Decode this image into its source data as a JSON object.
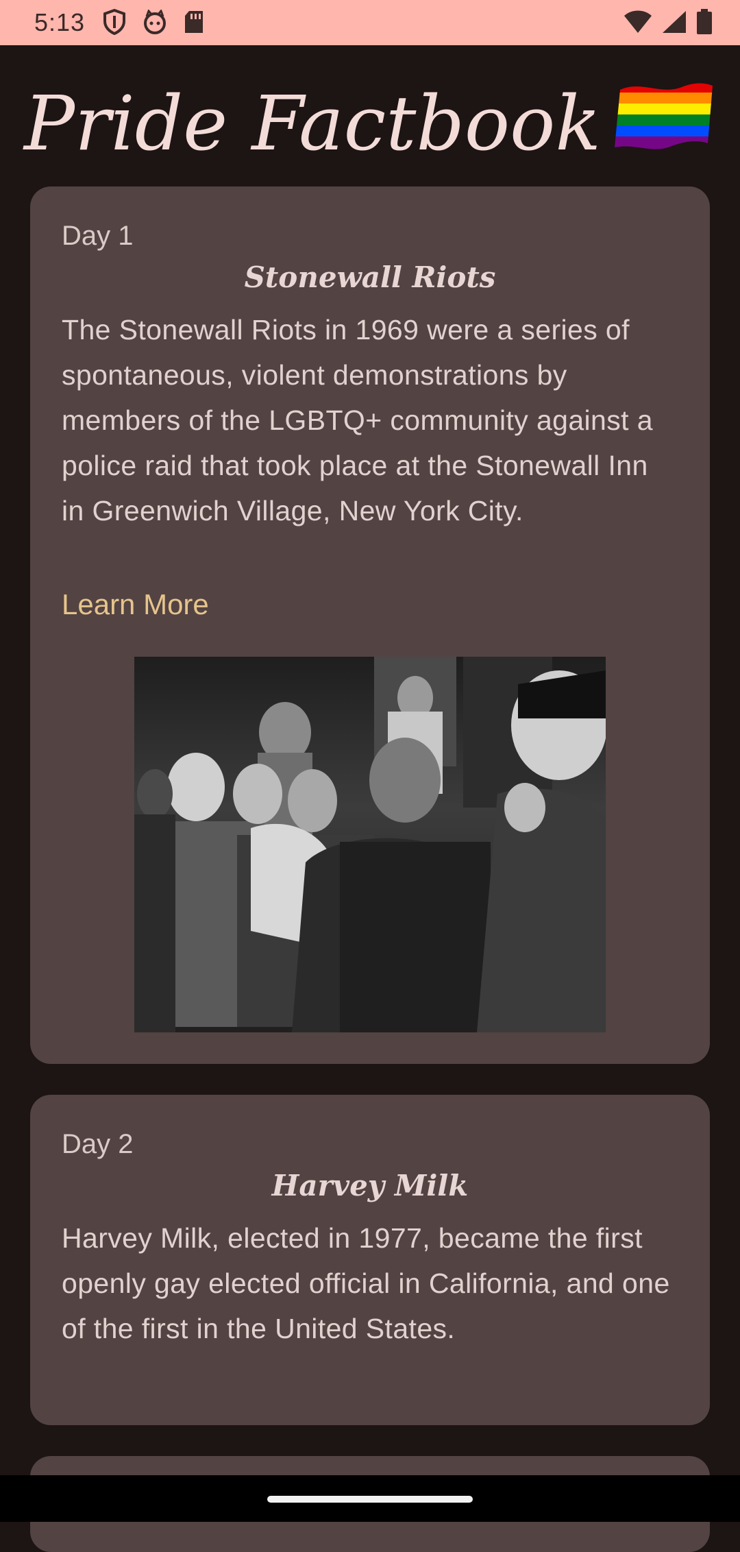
{
  "status_bar": {
    "time": "5:13",
    "left_icons": [
      "shield-icon",
      "cat-face-icon",
      "sd-card-icon"
    ],
    "right_icons": [
      "wifi-icon",
      "signal-icon",
      "battery-icon"
    ],
    "background": "#ffb6ad"
  },
  "app": {
    "title": "Pride Factbook",
    "title_emoji": "rainbow-flag-icon"
  },
  "cards": [
    {
      "day": "Day 1",
      "title": "Stonewall Riots",
      "body": "The Stonewall Riots in 1969 were a series of spontaneous, violent demonstrations by members of the LGBTQ+ community against a police raid that took place at the Stonewall Inn in Greenwich Village, New York City.",
      "link": "Learn More",
      "image": "stonewall-riots-photo"
    },
    {
      "day": "Day 2",
      "title": "Harvey Milk",
      "body": "Harvey Milk, elected in 1977, became the first openly gay elected official in California, and one of the first in the United States."
    }
  ],
  "colors": {
    "background": "#1d1414",
    "card": "#534343",
    "title_text": "#f3dcd8",
    "link": "#e6c48c"
  }
}
